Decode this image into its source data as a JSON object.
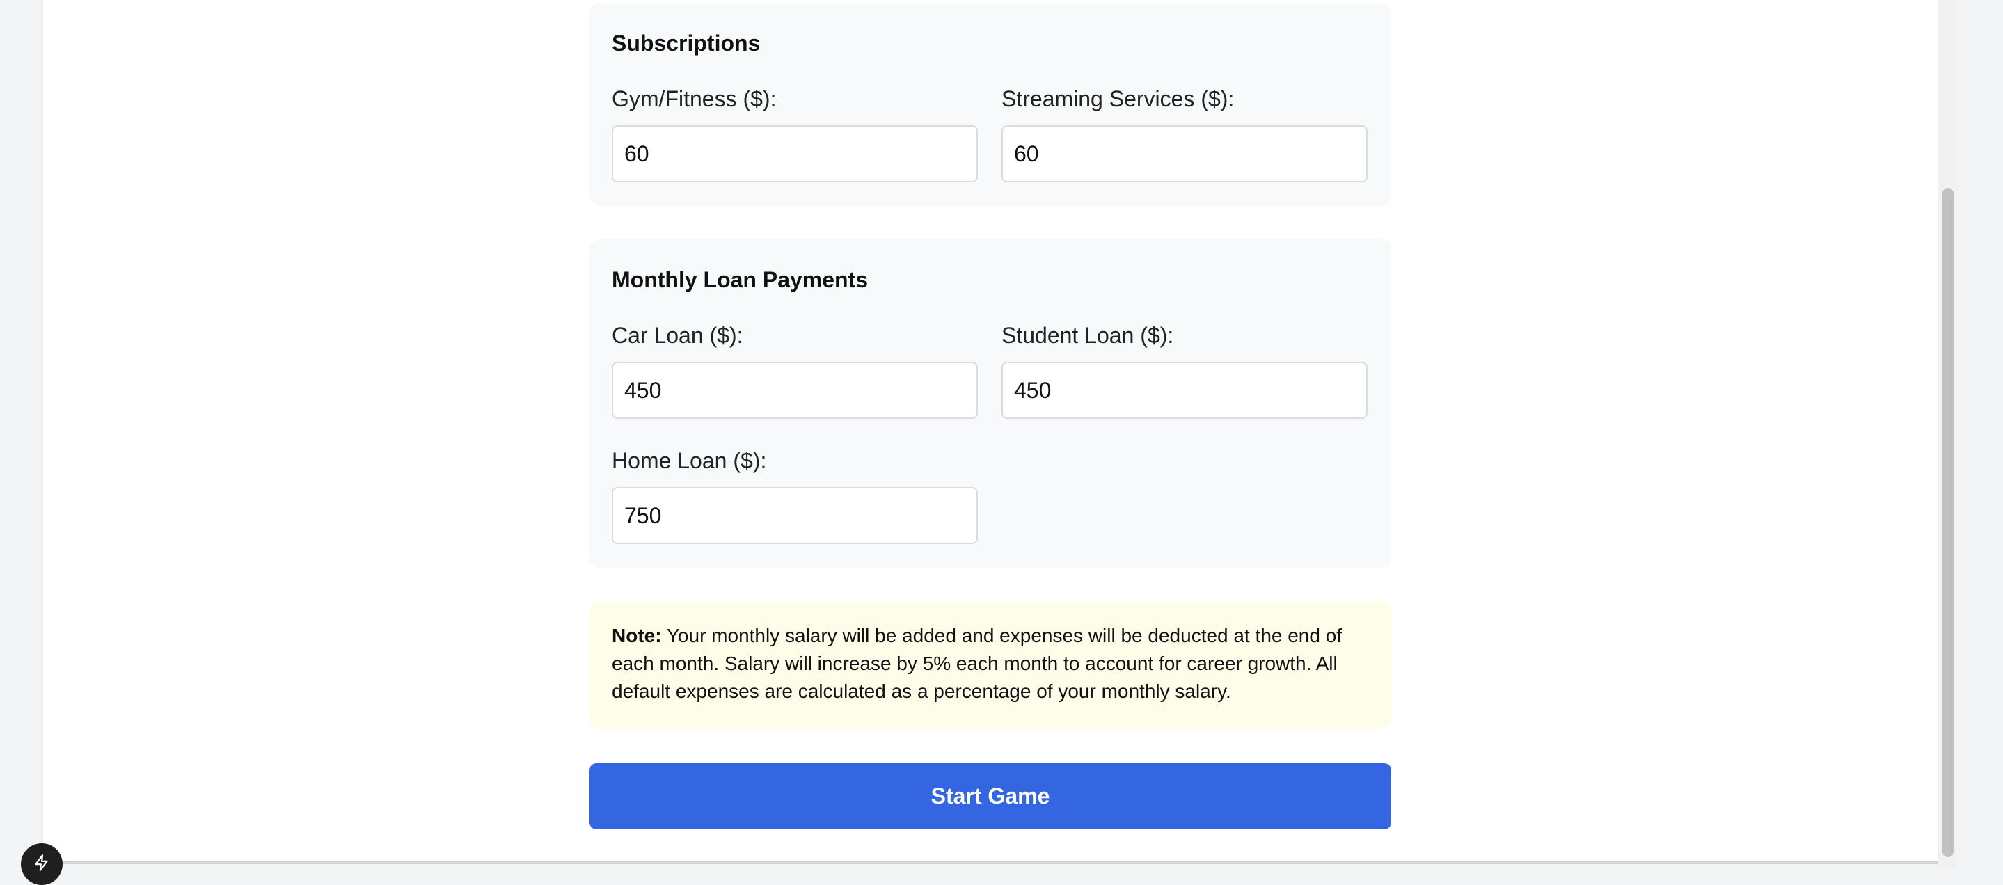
{
  "subscriptions": {
    "title": "Subscriptions",
    "gym_label": "Gym/Fitness ($):",
    "gym_value": "60",
    "streaming_label": "Streaming Services ($):",
    "streaming_value": "60"
  },
  "loans": {
    "title": "Monthly Loan Payments",
    "car_label": "Car Loan ($):",
    "car_value": "450",
    "student_label": "Student Loan ($):",
    "student_value": "450",
    "home_label": "Home Loan ($):",
    "home_value": "750"
  },
  "note": {
    "label": "Note:",
    "text": " Your monthly salary will be added and expenses will be deducted at the end of each month. Salary will increase by 5% each month to account for career growth. All default expenses are calculated as a percentage of your monthly salary."
  },
  "start_button": {
    "label": "Start Game"
  },
  "fab": {
    "icon": "lightning-bolt-icon"
  },
  "colors": {
    "accent": "#3366e0",
    "section_bg": "#f8f9fb",
    "note_bg": "#fdfde9",
    "page_bg": "#f3f4f6"
  }
}
